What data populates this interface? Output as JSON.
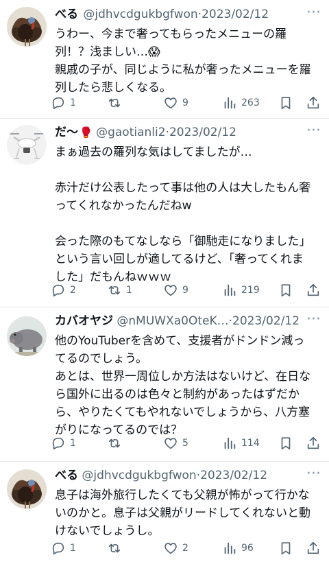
{
  "tweets": [
    {
      "name": "べる",
      "emoji": "",
      "handle": "@jdhvcdgukbgfwon",
      "sep": "·",
      "date": "2023/02/12",
      "more": "···",
      "lines": [
        "うわー、今まで奢ってもらったメニューの羅",
        "列！？浅ましい…😱",
        "親戚の子が、同じように私が奢ったメニューを羅",
        "列したら悲しくなる。"
      ],
      "reply_count": "1",
      "retweet_count": "",
      "like_count": "9",
      "view_count": "263",
      "avatar_icon": "turkey-avatar-icon"
    },
    {
      "name": "だ〜",
      "emoji": "🥊",
      "handle": "@gaotianli2",
      "sep": "·",
      "date": "2023/02/12",
      "more": "···",
      "lines": [
        "まぁ過去の羅列な気はしてましたが…",
        "",
        "赤汁だけ公表したって事は他の人は大したもん奢",
        "ってくれなかったんだねw",
        "",
        "会った際のもてなしなら「御馳走になりました」",
        "という言い回しが適してるけど、「奢ってくれま",
        "した」だもんねｗｗｗ"
      ],
      "reply_count": "2",
      "retweet_count": "1",
      "like_count": "9",
      "view_count": "219",
      "avatar_icon": "drone-avatar-icon"
    },
    {
      "name": "カバオヤジ",
      "emoji": "",
      "handle": "@nMUWXa0OteK…",
      "sep": "·",
      "date": "2023/02/12",
      "more": "···",
      "lines": [
        "他のYouTuberを含めて、支援者がドンドン減っ",
        "てるのでしょう。",
        "あとは、世界一周位しか方法はないけど、在日な",
        "ら国外に出るのは色々と制約があったはずだか",
        "ら、やりたくてもやれないでしょうから、八方塞",
        "がりになってるのでは？"
      ],
      "reply_count": "1",
      "retweet_count": "",
      "like_count": "5",
      "view_count": "114",
      "avatar_icon": "hippo-avatar-icon"
    },
    {
      "name": "べる",
      "emoji": "",
      "handle": "@jdhvcdgukbgfwon",
      "sep": "·",
      "date": "2023/02/12",
      "more": "···",
      "lines": [
        "息子は海外旅行したくても父親が怖がって行かな",
        "いのかと。息子は父親がリードしてくれないと動",
        "けないでしょうし。"
      ],
      "reply_count": "1",
      "retweet_count": "",
      "like_count": "2",
      "view_count": "96",
      "avatar_icon": "turkey-avatar-icon"
    }
  ],
  "icons": {
    "reply": "reply-icon",
    "retweet": "retweet-icon",
    "like": "like-icon",
    "views": "views-icon",
    "bookmark": "bookmark-icon",
    "share": "share-icon"
  },
  "colors": {
    "text": "#0f1419",
    "secondary": "#536471",
    "divider": "#e6e9ec"
  }
}
